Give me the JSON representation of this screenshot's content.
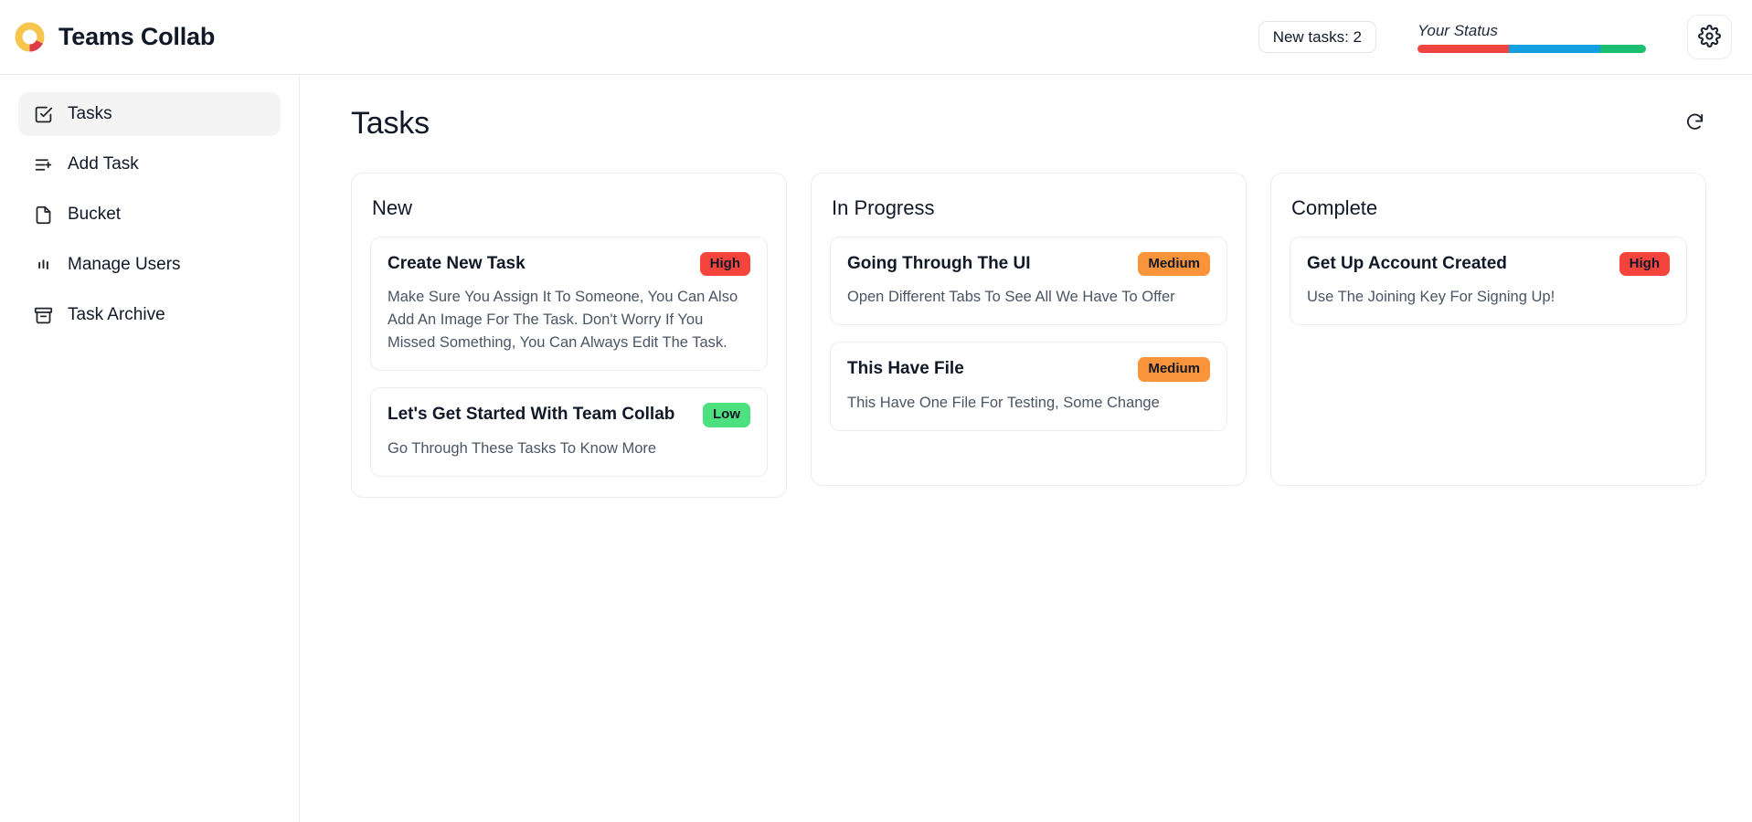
{
  "header": {
    "brand_title": "Teams Collab",
    "logo_icon": "donut-ring-logo",
    "logo_colors": {
      "primary": "#f7c44c",
      "secondary": "#dc3d4b"
    },
    "new_tasks_chip": "New tasks: 2",
    "status_label": "Your Status",
    "status_bar": {
      "segments": [
        {
          "name": "red",
          "color": "#ee4540",
          "percent": 40
        },
        {
          "name": "blue",
          "color": "#139fe0",
          "percent": 40
        },
        {
          "name": "green",
          "color": "#1bbf72",
          "percent": 20
        }
      ]
    },
    "settings_icon": "gear-icon"
  },
  "sidebar": {
    "items": [
      {
        "label": "Tasks",
        "icon": "check-square-icon",
        "active": true
      },
      {
        "label": "Add Task",
        "icon": "list-plus-icon",
        "active": false
      },
      {
        "label": "Bucket",
        "icon": "file-icon",
        "active": false
      },
      {
        "label": "Manage Users",
        "icon": "audio-lines-icon",
        "active": false
      },
      {
        "label": "Task Archive",
        "icon": "archive-icon",
        "active": false
      }
    ]
  },
  "main": {
    "page_title": "Tasks",
    "refresh_icon": "refresh-cw-icon",
    "priority_colors": {
      "High": "#f4443c",
      "Medium": "#f9943b",
      "Low": "#4ce07f"
    },
    "columns": [
      {
        "title": "New",
        "tasks": [
          {
            "title": "Create New Task",
            "priority": "High",
            "description": "Make Sure You Assign It To Someone, You Can Also Add An Image For The Task. Don't Worry If You Missed Something, You Can Always Edit The Task."
          },
          {
            "title": "Let's Get Started With Team Collab",
            "priority": "Low",
            "description": "Go Through These Tasks To Know More"
          }
        ]
      },
      {
        "title": "In Progress",
        "tasks": [
          {
            "title": "Going Through The UI",
            "priority": "Medium",
            "description": "Open Different Tabs To See All We Have To Offer"
          },
          {
            "title": "This Have File",
            "priority": "Medium",
            "description": "This Have One File For Testing, Some Change"
          }
        ]
      },
      {
        "title": "Complete",
        "tasks": [
          {
            "title": "Get Up Account Created",
            "priority": "High",
            "description": "Use The Joining Key For Signing Up!"
          }
        ]
      }
    ]
  }
}
